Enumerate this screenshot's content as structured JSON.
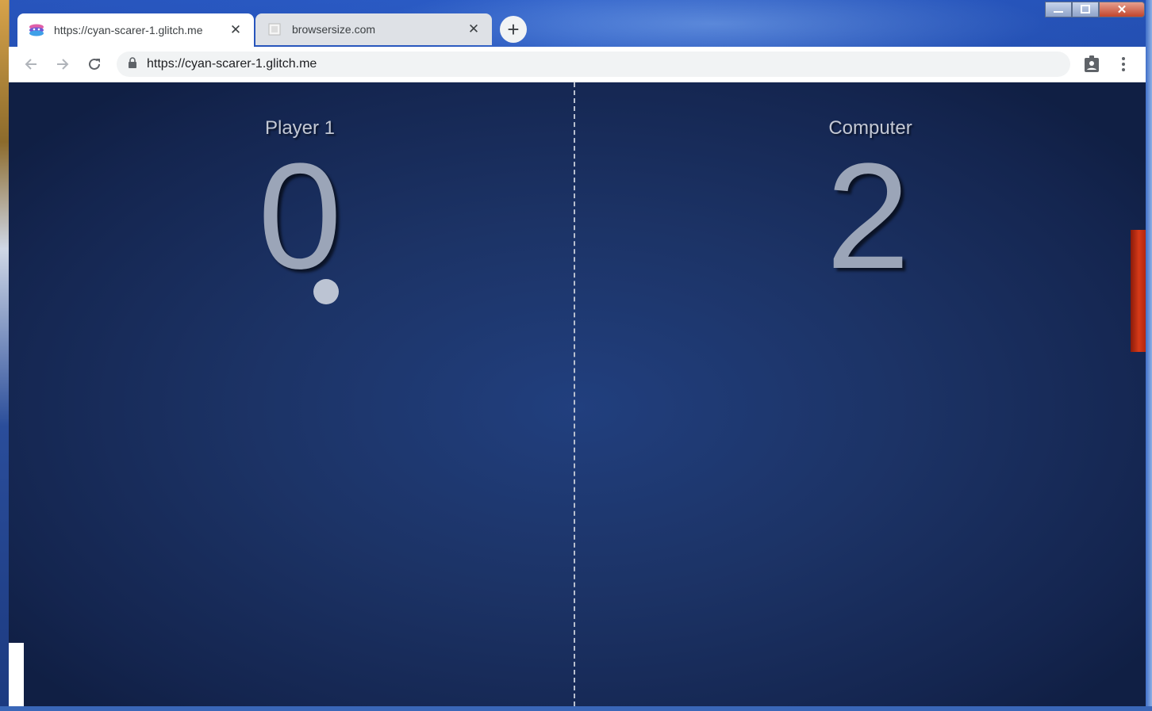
{
  "browser": {
    "tabs": [
      {
        "title": "https://cyan-scarer-1.glitch.me",
        "active": true,
        "icon": "glitch-favicon"
      },
      {
        "title": "browsersize.com",
        "active": false,
        "icon": "page-favicon"
      }
    ],
    "new_tab_symbol": "+",
    "address_bar": {
      "url": "https://cyan-scarer-1.glitch.me",
      "lock_icon": "lock-icon"
    },
    "nav": {
      "back": "←",
      "forward": "→",
      "reload": "↻",
      "menu": "⋮"
    },
    "window_controls": {
      "minimize": "—",
      "maximize": "▭",
      "close": "✕"
    }
  },
  "game": {
    "player": {
      "label": "Player 1",
      "score": "0"
    },
    "computer": {
      "label": "Computer",
      "score": "2"
    },
    "colors": {
      "paddle_player": "#ffffff",
      "paddle_computer": "#d63a18",
      "ball": "#bcc4d3"
    }
  }
}
